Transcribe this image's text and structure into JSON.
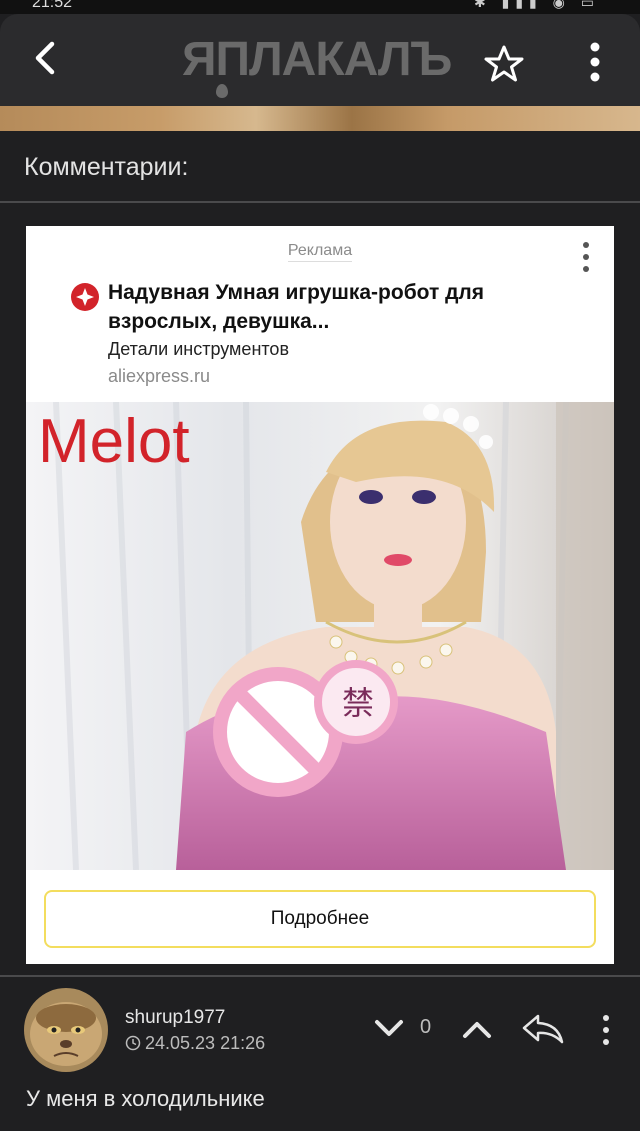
{
  "status_bar": {
    "time": "21:52",
    "icons": "wifi-signal-battery"
  },
  "header": {
    "site_logo": "ЯПЛАКАЛЪ",
    "icons": {
      "back": "back-icon",
      "favorite": "star-icon",
      "menu": "more-vertical-icon"
    }
  },
  "comments": {
    "heading": "Комментарии:"
  },
  "ad": {
    "label": "Реклама",
    "title": "Надувная Умная игрушка-робот для взрослых, девушка...",
    "description": "Детали инструментов",
    "domain": "aliexpress.ru",
    "image_brand_text": "Melot",
    "button_label": "Подробнее",
    "colors": {
      "brand_red": "#d2232a",
      "button_border": "#f3dd5e"
    }
  },
  "comment": {
    "username": "shurup1977",
    "date": "24.05.23 21:26",
    "score": "0",
    "text": "У меня в холодильнике",
    "icons": {
      "down": "chevron-down-icon",
      "up": "chevron-up-icon",
      "reply": "reply-icon",
      "menu": "more-vertical-icon",
      "date": "clock-icon"
    }
  }
}
